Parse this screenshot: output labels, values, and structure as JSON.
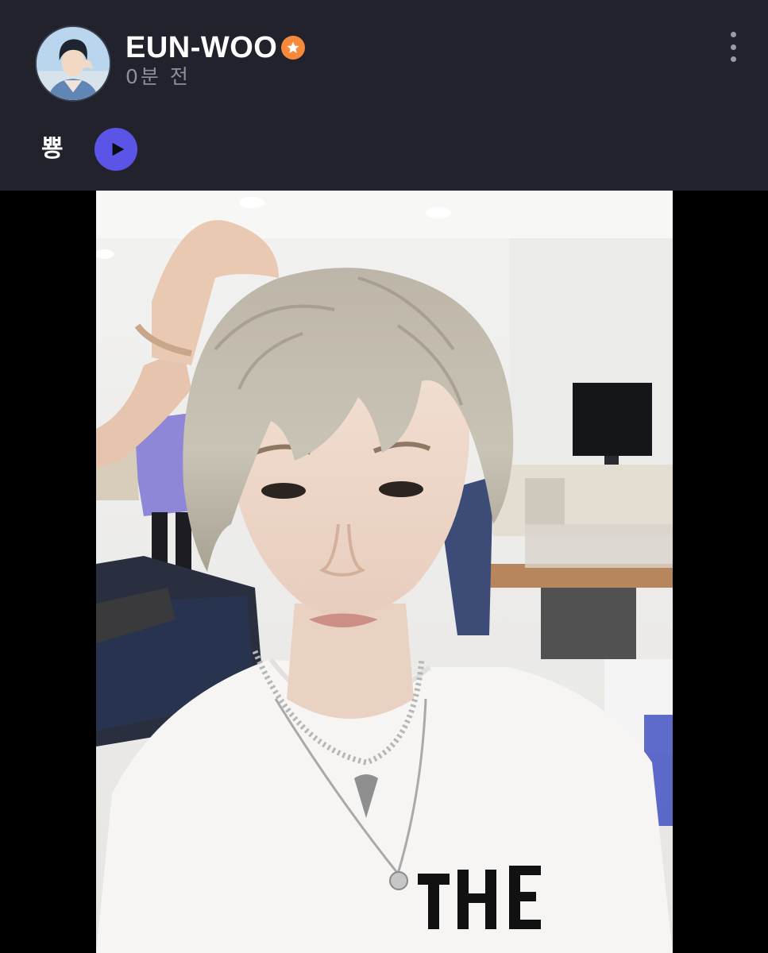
{
  "post": {
    "author_name": "EUN-WOO",
    "time_ago": "0분 전",
    "voice_text": "뿅"
  },
  "icons": {
    "verified": "star-badge-icon",
    "more": "vertical-dots-icon",
    "play": "play-icon"
  },
  "colors": {
    "header_bg": "#21222c",
    "badge": "#f6893a",
    "play_button": "#5a55e6"
  }
}
